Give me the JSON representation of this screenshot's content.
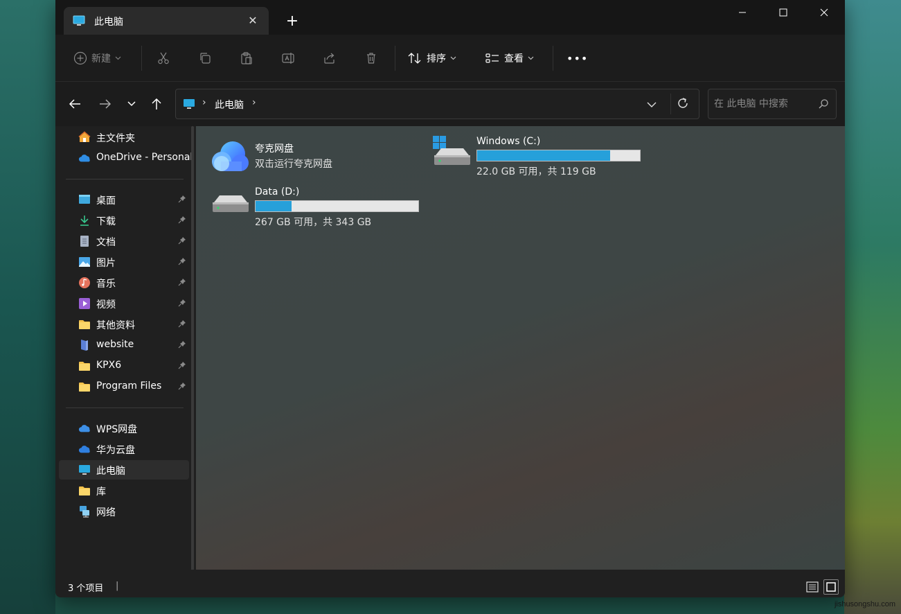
{
  "window": {
    "tab_title": "此电脑",
    "tab_close": "✕",
    "new_tab": "+"
  },
  "toolbar": {
    "new_label": "新建",
    "sort_label": "排序",
    "view_label": "查看",
    "more_label": "•••"
  },
  "address": {
    "crumb": "此电脑",
    "search_placeholder": "在 此电脑 中搜索"
  },
  "sidebar": {
    "quick": [
      {
        "label": "主文件夹",
        "icon": "home-icon"
      },
      {
        "label": "OneDrive - Personal",
        "icon": "onedrive-icon"
      }
    ],
    "pinned": [
      {
        "label": "桌面",
        "icon": "desktop-icon"
      },
      {
        "label": "下载",
        "icon": "download-icon"
      },
      {
        "label": "文档",
        "icon": "document-icon"
      },
      {
        "label": "图片",
        "icon": "pictures-icon"
      },
      {
        "label": "音乐",
        "icon": "music-icon"
      },
      {
        "label": "视频",
        "icon": "video-icon"
      },
      {
        "label": "其他资料",
        "icon": "folder-icon"
      },
      {
        "label": "website",
        "icon": "website-icon"
      },
      {
        "label": "KPX6",
        "icon": "folder-icon"
      },
      {
        "label": "Program Files",
        "icon": "folder-icon"
      }
    ],
    "locations": [
      {
        "label": "WPS网盘",
        "icon": "cloud-icon"
      },
      {
        "label": "华为云盘",
        "icon": "cloud-icon"
      },
      {
        "label": "此电脑",
        "icon": "pc-icon",
        "selected": true
      },
      {
        "label": "库",
        "icon": "folder-icon"
      },
      {
        "label": "网络",
        "icon": "network-icon"
      }
    ]
  },
  "content": {
    "quark": {
      "name": "夸克网盘",
      "subtitle": "双击运行夸克网盘"
    },
    "drive_c": {
      "name": "Windows (C:)",
      "usage": "22.0 GB 可用，共 119 GB",
      "used_fraction": 0.815
    },
    "drive_d": {
      "name": "Data (D:)",
      "usage": "267 GB 可用，共 343 GB",
      "used_fraction": 0.222
    }
  },
  "status": {
    "item_count": "3 个项目",
    "separator": "|"
  },
  "colors": {
    "accent": "#26a0da",
    "window_bg": "#202020"
  },
  "watermark": "jishusongshu.com"
}
